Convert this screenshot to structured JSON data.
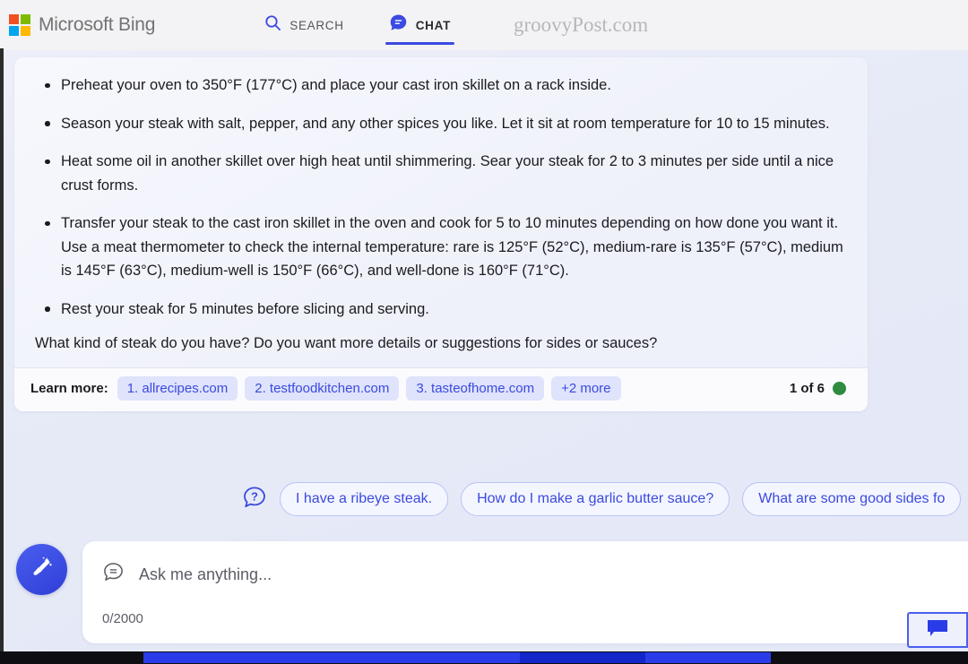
{
  "header": {
    "brand": "Microsoft Bing",
    "tabs": [
      {
        "id": "search",
        "label": "SEARCH",
        "icon": "search-icon",
        "active": false
      },
      {
        "id": "chat",
        "label": "CHAT",
        "icon": "chat-bubble-icon",
        "active": true
      }
    ],
    "watermark": "groovyPost.com",
    "colors": {
      "logo_red": "#f25022",
      "logo_green": "#7fba00",
      "logo_blue": "#00a4ef",
      "logo_yellow": "#ffb900",
      "accent": "#3b4ae0",
      "header_bg": "#f3f3f5"
    }
  },
  "answer": {
    "steps": [
      "Preheat your oven to 350°F (177°C) and place your cast iron skillet on a rack inside.",
      "Season your steak with salt, pepper, and any other spices you like. Let it sit at room temperature for 10 to 15 minutes.",
      "Heat some oil in another skillet over high heat until shimmering. Sear your steak for 2 to 3 minutes per side until a nice crust forms.",
      "Transfer your steak to the cast iron skillet in the oven and cook for 5 to 10 minutes depending on how done you want it. Use a meat thermometer to check the internal temperature: rare is 125°F (52°C), medium-rare is 135°F (57°C), medium is 145°F (63°C), medium-well is 150°F (66°C), and well-done is 160°F (71°C).",
      "Rest your steak for 5 minutes before slicing and serving."
    ],
    "closing_question": "What kind of steak do you have? Do you want more details or suggestions for sides or sauces?"
  },
  "learn_more": {
    "label": "Learn more:",
    "citations": [
      "1. allrecipes.com",
      "2. testfoodkitchen.com",
      "3. tasteofhome.com"
    ],
    "more_label": "+2 more",
    "counter": "1 of 6",
    "status_dot_color": "#2e8b3f",
    "chip_bg": "#dfe3fb",
    "chip_text": "#3b4ae0"
  },
  "suggestions": {
    "help_icon": "question-bubble-icon",
    "chips": [
      "I have a ribeye steak.",
      "How do I make a garlic butter sauce?",
      "What are some good sides fo"
    ]
  },
  "composer": {
    "sweep_icon": "broom-icon",
    "input_icon": "chat-bubble-outline-icon",
    "placeholder": "Ask me anything...",
    "char_count": "0/2000"
  },
  "feedback": {
    "icon": "feedback-chat-icon"
  }
}
